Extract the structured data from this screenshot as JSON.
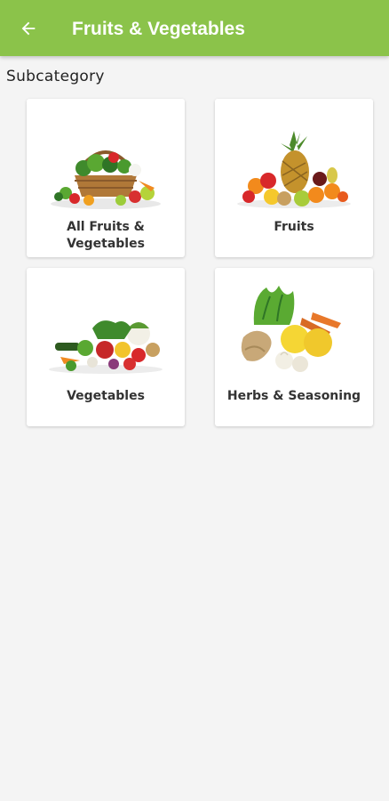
{
  "appbar": {
    "title": "Fruits & Vegetables",
    "back_icon": "arrow-left-icon",
    "color": "#8bc34a"
  },
  "section": {
    "title": "Subcategory"
  },
  "categories": [
    {
      "label": "All Fruits & Vegetables",
      "icon": "vegetable-basket-image"
    },
    {
      "label": "Fruits",
      "icon": "fruit-pile-image"
    },
    {
      "label": "Vegetables",
      "icon": "vegetable-pile-image"
    },
    {
      "label": "Herbs & Seasoning",
      "icon": "herbs-seasoning-image"
    }
  ]
}
